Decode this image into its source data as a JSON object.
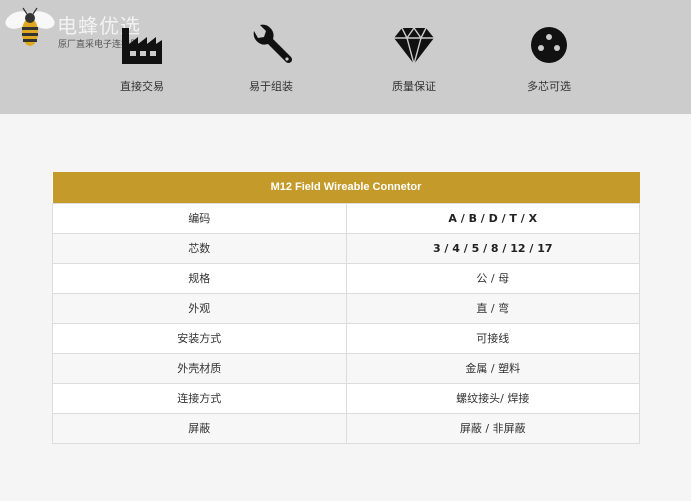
{
  "logo": {
    "title": "电蜂优选",
    "subtitle": "原厂直采电子连接器"
  },
  "features": [
    {
      "icon": "factory-icon",
      "label": "直接交易"
    },
    {
      "icon": "wrench-icon",
      "label": "易于组装"
    },
    {
      "icon": "diamond-icon",
      "label": "质量保证"
    },
    {
      "icon": "connector-pins-icon",
      "label": "多芯可选"
    }
  ],
  "table": {
    "title": "M12 Field Wireable Connetor",
    "rows": [
      {
        "label": "编码",
        "value": "A / B / D / T / X"
      },
      {
        "label": "芯数",
        "value": "3 / 4 / 5 / 8 / 12 / 17"
      },
      {
        "label": "规格",
        "value": "公 / 母"
      },
      {
        "label": "外观",
        "value": "直 / 弯"
      },
      {
        "label": "安装方式",
        "value": "可接线"
      },
      {
        "label": "外壳材质",
        "value": "金属 / 塑料"
      },
      {
        "label": "连接方式",
        "value": "螺纹接头/ 焊接"
      },
      {
        "label": "屏蔽",
        "value": "屏蔽 / 非屏蔽"
      }
    ]
  },
  "colors": {
    "banner": "#cccccc",
    "table_header": "#c49a2a",
    "page_bg": "#f5f5f5"
  }
}
